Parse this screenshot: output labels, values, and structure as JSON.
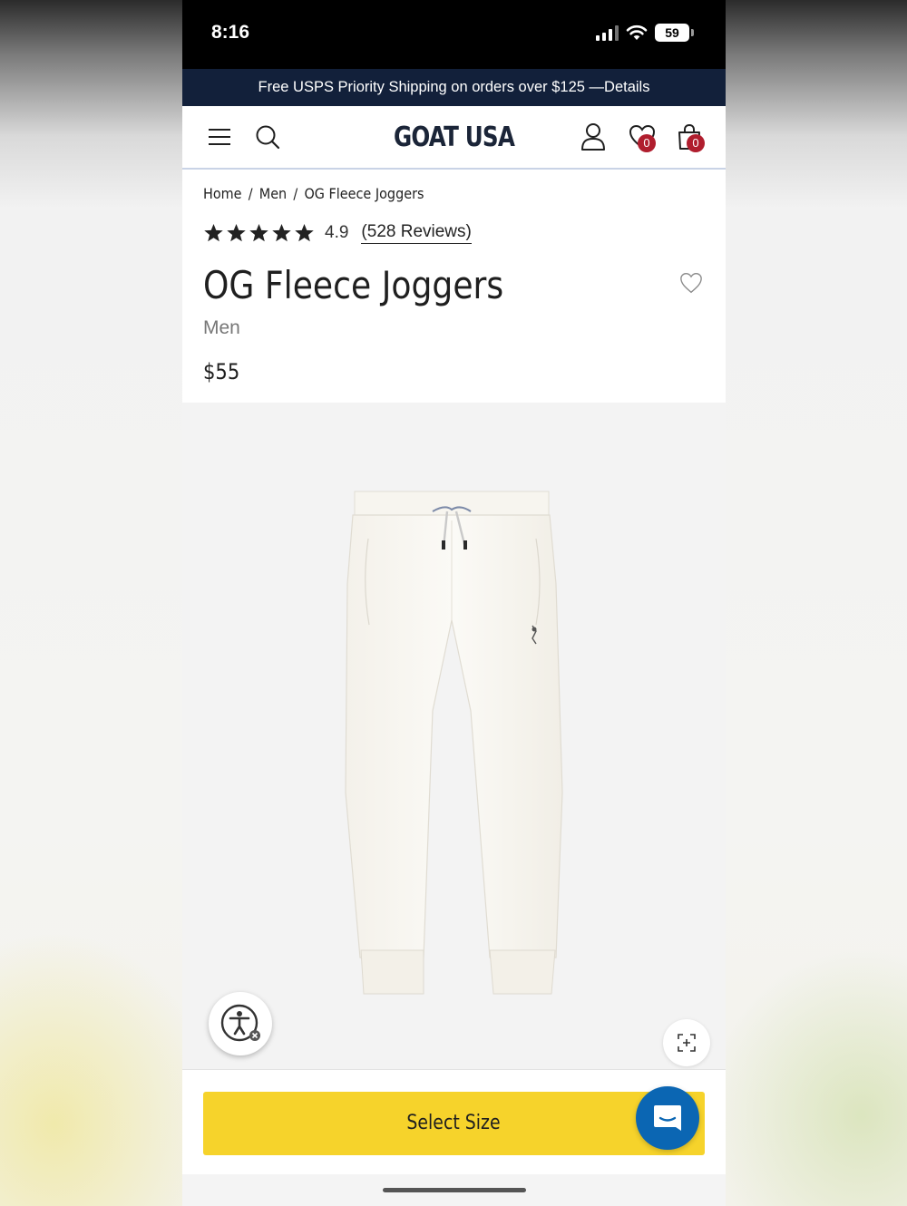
{
  "status_bar": {
    "time": "8:16",
    "battery": "59",
    "icons": [
      "cellular-signal-icon",
      "wifi-icon",
      "battery-icon"
    ]
  },
  "promo": {
    "text": "Free USPS Priority Shipping on orders over $125 —",
    "link": "Details"
  },
  "header": {
    "logo": "GOAT USA",
    "wishlist_count": "0",
    "cart_count": "0",
    "icons": [
      "menu-icon",
      "search-icon",
      "account-icon",
      "heart-icon",
      "shopping-bag-icon"
    ]
  },
  "breadcrumb": {
    "items": [
      "Home",
      "Men",
      "OG Fleece Joggers"
    ],
    "separator": "/"
  },
  "product": {
    "rating": "4.9",
    "stars": 5,
    "reviews_link": "(528 Reviews)",
    "title": "OG Fleece Joggers",
    "category": "Men",
    "price": "$55",
    "image_icons": [
      "accessibility-icon",
      "zoom-icon"
    ]
  },
  "actions": {
    "select_size": "Select Size",
    "chat_icon": "chat-icon"
  },
  "colors": {
    "promo_bg": "#12203a",
    "logo": "#1b2538",
    "badge": "#b01e2e",
    "cta": "#f6d32b",
    "chat": "#0b66b3"
  }
}
